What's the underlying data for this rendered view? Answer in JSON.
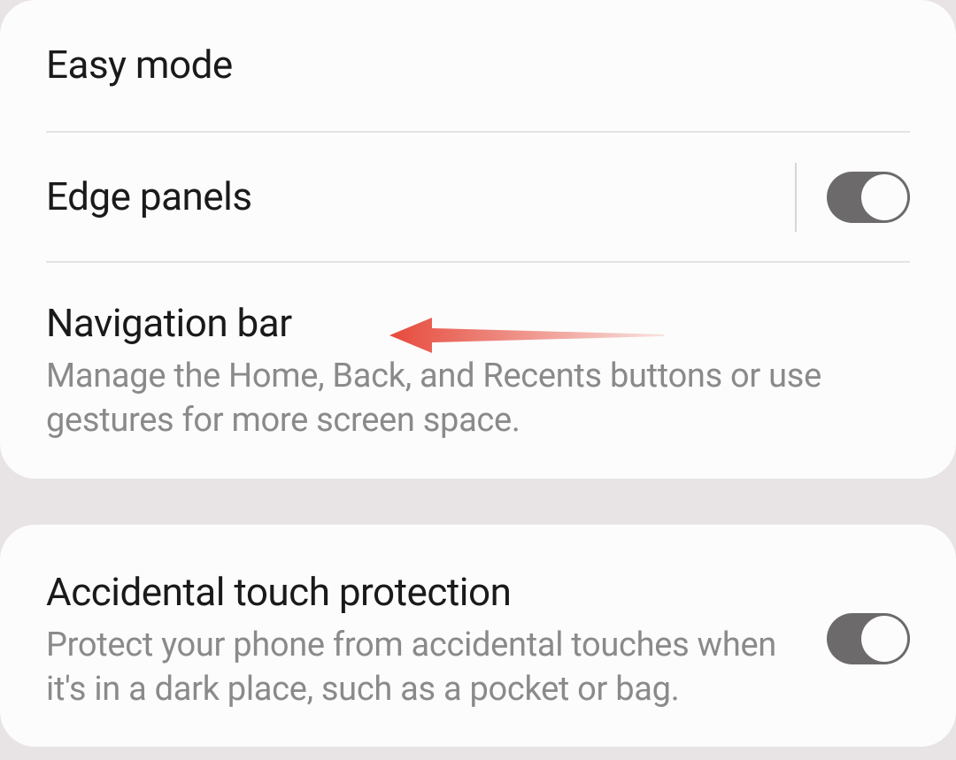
{
  "group1": {
    "easy_mode": {
      "title": "Easy mode"
    },
    "edge_panels": {
      "title": "Edge panels",
      "toggle_on": true
    },
    "navigation_bar": {
      "title": "Navigation bar",
      "description": "Manage the Home, Back, and Recents buttons or use gestures for more screen space."
    }
  },
  "group2": {
    "accidental_touch": {
      "title": "Accidental touch protection",
      "description": "Protect your phone from accidental touches when it's in a dark place, such as a pocket or bag.",
      "toggle_on": true
    }
  }
}
